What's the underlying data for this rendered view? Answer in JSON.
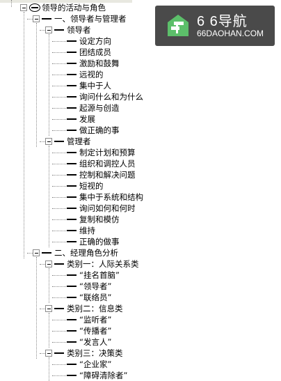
{
  "watermark": {
    "title": "6 6导航",
    "subtitle": "66DAOHAN.COM"
  },
  "tree": [
    {
      "label": "领导的活动与角色",
      "kind": "root",
      "name": "tree-node-root",
      "children": [
        {
          "label": "一、领导者与管理者",
          "kind": "section",
          "children": [
            {
              "label": "领导者",
              "kind": "section",
              "children": [
                {
                  "label": "设定方向"
                },
                {
                  "label": "团结成员"
                },
                {
                  "label": "激励和鼓舞"
                },
                {
                  "label": "远视的"
                },
                {
                  "label": "集中于人"
                },
                {
                  "label": "询问什么和为什么"
                },
                {
                  "label": "起源与创造"
                },
                {
                  "label": "发展"
                },
                {
                  "label": "做正确的事"
                }
              ]
            },
            {
              "label": "管理者",
              "kind": "section",
              "children": [
                {
                  "label": "制定计划和预算"
                },
                {
                  "label": "组织和调控人员"
                },
                {
                  "label": "控制和解决问题"
                },
                {
                  "label": "短视的"
                },
                {
                  "label": "集中于系统和结构"
                },
                {
                  "label": "询问如何和何时"
                },
                {
                  "label": "复制和模仿"
                },
                {
                  "label": "维持"
                },
                {
                  "label": "正确的做事"
                }
              ]
            }
          ]
        },
        {
          "label": "二、经理角色分析",
          "kind": "section",
          "children": [
            {
              "label": "类别一：人际关系类",
              "kind": "section",
              "children": [
                {
                  "label": "“挂名首脑”"
                },
                {
                  "label": "“领导者”"
                },
                {
                  "label": "“联络员”"
                }
              ]
            },
            {
              "label": "类别二：信息类",
              "kind": "section",
              "children": [
                {
                  "label": "“监听者”"
                },
                {
                  "label": "“传播者”"
                },
                {
                  "label": "“发言人”"
                }
              ]
            },
            {
              "label": "类别三：决策类",
              "kind": "section",
              "children": [
                {
                  "label": "“企业家”"
                },
                {
                  "label": "“障碍清除者”"
                }
              ]
            }
          ]
        }
      ]
    }
  ]
}
